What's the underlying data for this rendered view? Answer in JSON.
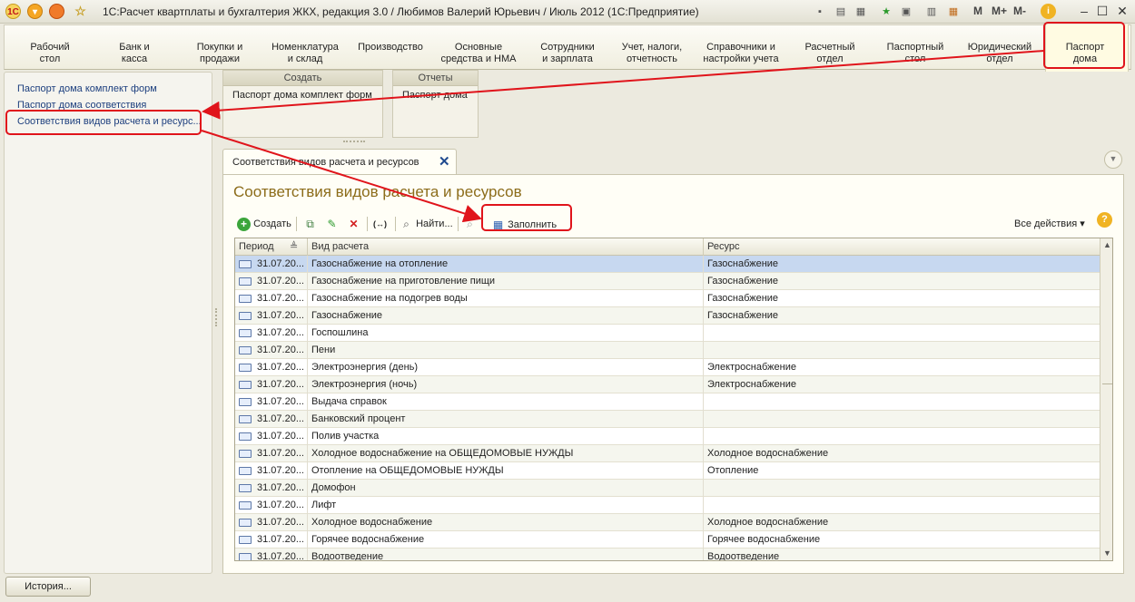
{
  "window": {
    "title": "1С:Расчет квартплаты и бухгалтерия ЖКХ, редакция 3.0 / Любимов Валерий Юрьевич / Июль 2012  (1С:Предприятие)",
    "memory_buttons": [
      "M",
      "M+",
      "M-"
    ],
    "controls": [
      "minimize",
      "maximize",
      "close"
    ]
  },
  "sections": [
    {
      "label": "Рабочий\nстол"
    },
    {
      "label": "Банк и\nкасса"
    },
    {
      "label": "Покупки и\nпродажи"
    },
    {
      "label": "Номенклатура\nи склад"
    },
    {
      "label": "Производство"
    },
    {
      "label": "Основные\nсредства и НМА"
    },
    {
      "label": "Сотрудники\nи зарплата"
    },
    {
      "label": "Учет, налоги,\nотчетность"
    },
    {
      "label": "Справочники и\nнастройки учета"
    },
    {
      "label": "Расчетный\nотдел"
    },
    {
      "label": "Паспортный\nстол"
    },
    {
      "label": "Юридический\nотдел"
    },
    {
      "label": "Паспорт\nдома"
    }
  ],
  "nav": [
    "Паспорт дома комплект форм",
    "Паспорт дома соответствия",
    "Соответствия видов расчета и ресурс..."
  ],
  "command_groups": {
    "create": {
      "title": "Создать",
      "item": "Паспорт дома комплект форм"
    },
    "reports": {
      "title": "Отчеты",
      "item": "Паспорт дома"
    }
  },
  "tab": {
    "label": "Соответствия видов расчета и ресурсов"
  },
  "form": {
    "title": "Соответствия видов расчета и ресурсов",
    "toolbar": {
      "create": "Создать",
      "find": "Найти...",
      "fill": "Заполнить",
      "all_actions": "Все действия ▾",
      "help": "?"
    },
    "columns": [
      "Период",
      "Вид расчета",
      "Ресурс"
    ],
    "rows": [
      {
        "period": "31.07.20...",
        "kind": "Газоснабжение на отопление",
        "resource": "Газоснабжение"
      },
      {
        "period": "31.07.20...",
        "kind": "Газоснабжение на приготовление пищи",
        "resource": "Газоснабжение"
      },
      {
        "period": "31.07.20...",
        "kind": "Газоснабжение на подогрев воды",
        "resource": "Газоснабжение"
      },
      {
        "period": "31.07.20...",
        "kind": "Газоснабжение",
        "resource": "Газоснабжение"
      },
      {
        "period": "31.07.20...",
        "kind": "Госпошлина",
        "resource": ""
      },
      {
        "period": "31.07.20...",
        "kind": "Пени",
        "resource": ""
      },
      {
        "period": "31.07.20...",
        "kind": "Электроэнергия (день)",
        "resource": "Электроснабжение"
      },
      {
        "period": "31.07.20...",
        "kind": "Электроэнергия (ночь)",
        "resource": "Электроснабжение"
      },
      {
        "period": "31.07.20...",
        "kind": "Выдача справок",
        "resource": ""
      },
      {
        "period": "31.07.20...",
        "kind": "Банковский процент",
        "resource": ""
      },
      {
        "period": "31.07.20...",
        "kind": "Полив участка",
        "resource": ""
      },
      {
        "period": "31.07.20...",
        "kind": "Холодное водоснабжение на ОБЩЕДОМОВЫЕ НУЖДЫ",
        "resource": "Холодное водоснабжение"
      },
      {
        "period": "31.07.20...",
        "kind": "Отопление на ОБЩЕДОМОВЫЕ НУЖДЫ",
        "resource": "Отопление"
      },
      {
        "period": "31.07.20...",
        "kind": "Домофон",
        "resource": ""
      },
      {
        "period": "31.07.20...",
        "kind": "Лифт",
        "resource": ""
      },
      {
        "period": "31.07.20...",
        "kind": "Холодное водоснабжение",
        "resource": "Холодное водоснабжение"
      },
      {
        "period": "31.07.20...",
        "kind": "Горячее водоснабжение",
        "resource": "Горячее водоснабжение"
      },
      {
        "period": "31.07.20...",
        "kind": "Водоотведение",
        "resource": "Водоотведение"
      }
    ]
  },
  "history_button": "История...",
  "colors": {
    "highlight": "#e0141b",
    "title_accent": "#8c6c1a",
    "selected_row": "#c7d8f0",
    "link": "#1d3f7e"
  }
}
